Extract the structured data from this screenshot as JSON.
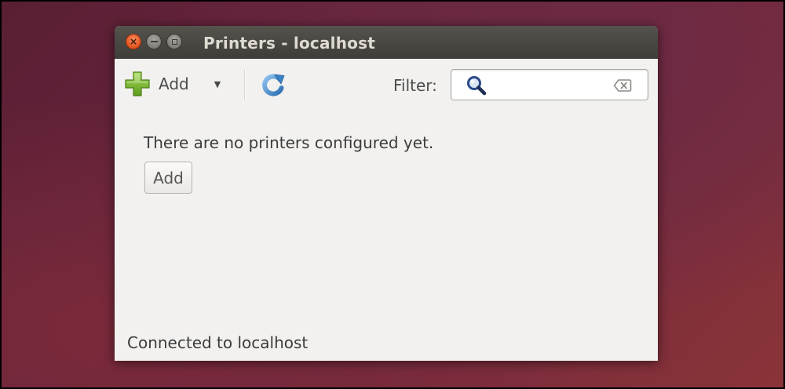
{
  "window": {
    "title": "Printers - localhost",
    "controls": {
      "close_glyph": "×"
    }
  },
  "toolbar": {
    "add_label": "Add",
    "dropdown_glyph": "▼",
    "add_icon": "plus-icon",
    "refresh_icon": "refresh-icon",
    "filter_label": "Filter:",
    "filter_value": "",
    "filter_placeholder": "",
    "search_icon": "search-icon",
    "clear_icon": "clear-text-icon"
  },
  "content": {
    "empty_message": "There are no printers configured yet.",
    "add_button_label": "Add"
  },
  "status": {
    "text": "Connected to localhost"
  },
  "colors": {
    "titlebar": "#3e3d39",
    "window_bg": "#f2f1f0",
    "close_button": "#e1531f",
    "plus_icon": "#73b12b",
    "refresh_icon": "#3f86c8",
    "search_icon": "#2b4a8a"
  }
}
